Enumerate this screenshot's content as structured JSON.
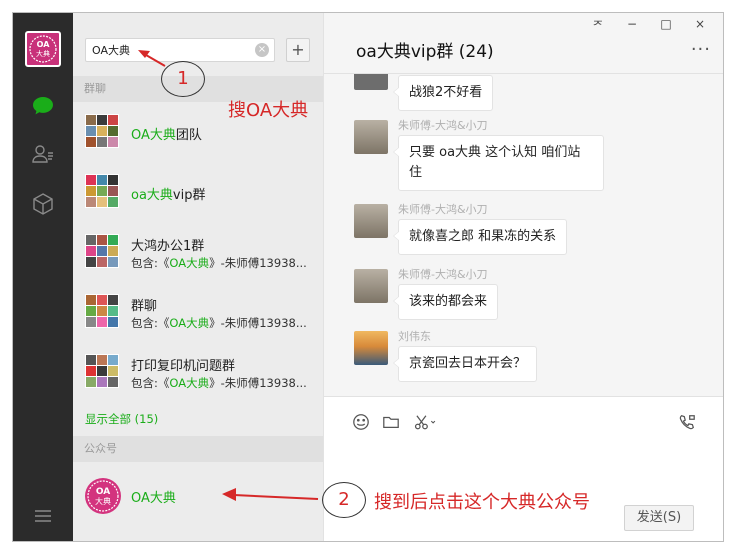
{
  "app": {
    "window_controls": [
      "ᅎ",
      "−",
      "□",
      "×"
    ],
    "window_control_names": [
      "pin",
      "minimize",
      "maximize",
      "close"
    ]
  },
  "rail": {
    "avatar_text": "OA大典",
    "icons": [
      "chat-icon",
      "contacts-icon",
      "favorites-icon",
      "menu-icon"
    ],
    "accent_color": "#1aad19"
  },
  "search": {
    "value": "OA大典",
    "clear_icon": "×",
    "add_label": "+"
  },
  "groups": {
    "header": "群聊",
    "items": [
      {
        "name_highlight": "OA大典",
        "name_rest": "团队"
      },
      {
        "name_highlight": "oa大典",
        "name_rest": "vip群"
      },
      {
        "name": "大鸿办公1群",
        "sub_prefix": "包含:《",
        "sub_highlight": "OA大典",
        "sub_rest": "》-朱师傅13938..."
      },
      {
        "name": "群聊",
        "sub_prefix": "包含:《",
        "sub_highlight": "OA大典",
        "sub_rest": "》-朱师傅13938..."
      },
      {
        "name": "打印复印机问题群",
        "sub_prefix": "包含:《",
        "sub_highlight": "OA大典",
        "sub_rest": "》-朱师傅13938..."
      }
    ],
    "show_all": "显示全部 (15)"
  },
  "public_accounts": {
    "header": "公众号",
    "items": [
      {
        "name": "OA大典",
        "avatar_text": "OA大典"
      }
    ]
  },
  "chat": {
    "title": "oa大典vip群 (24)",
    "more": "···",
    "messages": [
      {
        "sender": "",
        "text": "战狼2不好看"
      },
      {
        "sender": "朱师傅-大鸿&小刀",
        "text": "只要 oa大典 这个认知 咱们站住"
      },
      {
        "sender": "朱师傅-大鸿&小刀",
        "text": "就像喜之郎 和果冻的关系"
      },
      {
        "sender": "朱师傅-大鸿&小刀",
        "text": "该来的都会来"
      },
      {
        "sender": "刘伟东",
        "text": "京瓷回去日本开会？"
      }
    ],
    "tools": [
      "emoji-icon",
      "folder-icon",
      "scissors-icon",
      "video-call-icon"
    ],
    "send_label": "发送(S)"
  },
  "annotations": {
    "step1_number": "1",
    "step1_text": "搜OA大典",
    "step2_number": "2",
    "step2_text": "搜到后点击这个大典公众号",
    "color": "#d62828"
  }
}
